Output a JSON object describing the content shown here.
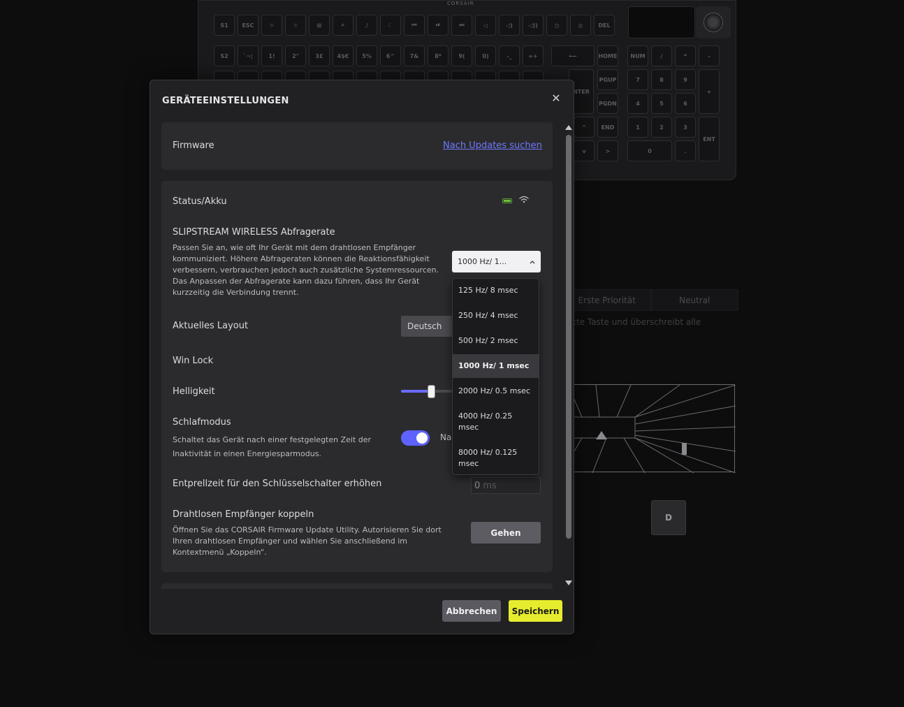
{
  "background": {
    "brand": "CORSAIR",
    "keys": {
      "row1": [
        "S1",
        "ESC",
        "☼",
        "☼",
        "⊞",
        "⌕",
        "♪",
        "☾",
        "⏮",
        "⏯",
        "⏭",
        "◁",
        "◁)",
        "◁))",
        "◷",
        "◎",
        "DEL"
      ],
      "row2": [
        "S2",
        "`¬¦",
        "1!",
        "2\"",
        "3£",
        "4$€",
        "5%",
        "6^",
        "7&",
        "8*",
        "9(",
        "0)",
        "-_",
        "=+",
        "⟵",
        "HOME"
      ],
      "numpad": [
        "NUM",
        "/",
        "*",
        "-",
        "7",
        "8",
        "9",
        "+",
        "4",
        "5",
        "6",
        "1",
        "2",
        "3",
        "ENT",
        "0",
        "."
      ],
      "nav": [
        "NTER",
        "PGUP",
        "PGDN",
        "^",
        "END",
        "v",
        ">"
      ]
    },
    "priority_left": "Erste Priorität",
    "priority_right": "Neutral",
    "desc": "kte Taste und überschreibt alle",
    "d_key": "D"
  },
  "modal": {
    "title": "GERÄTEEINSTELLUNGEN",
    "close": "✕",
    "firmware": {
      "label": "Firmware",
      "link": "Nach Updates suchen"
    },
    "status": {
      "label": "Status/Akku"
    },
    "polling": {
      "title": "SLIPSTREAM WIRELESS Abfragerate",
      "desc_lines": [
        "Passen Sie an, wie oft Ihr Gerät mit dem drahtlosen Empfänger",
        "kommuniziert. Höhere Abfrageraten können die Reaktionsfähigkeit",
        "verbessern, verbrauchen jedoch auch zusätzliche Systemressourcen.",
        "Das Anpassen der Abfragerate kann dazu führen, dass Ihr Gerät",
        "kurzzeitig die Verbindung trennt."
      ],
      "selected": "1000 Hz/ 1...",
      "options": [
        [
          "125 Hz/ 8 msec"
        ],
        [
          "250 Hz/ 4 msec"
        ],
        [
          "500 Hz/ 2 msec"
        ],
        [
          "1000 Hz/ 1 msec"
        ],
        [
          "2000 Hz/ 0.5 msec"
        ],
        [
          "4000 Hz/ 0.25",
          "msec"
        ],
        [
          "8000 Hz/ 0.125",
          "msec"
        ]
      ],
      "selected_index": 3
    },
    "layout": {
      "label": "Aktuelles Layout",
      "value": "Deutsch"
    },
    "winlock": {
      "label": "Win Lock"
    },
    "brightness": {
      "label": "Helligkeit",
      "level": 0.55
    },
    "sleep": {
      "label": "Schlafmodus",
      "desc_lines": [
        "Schaltet das Gerät nach einer festgelegten Zeit der",
        "Inaktivität in einen Energiesparmodus."
      ],
      "enabled": true,
      "after_text": "Na"
    },
    "debounce": {
      "label": "Entprellzeit für den Schlüsselschalter erhöhen",
      "value": "0",
      "unit": "ms"
    },
    "pair": {
      "label": "Drahtlosen Empfänger koppeln",
      "desc_lines": [
        "Öffnen Sie das CORSAIR Firmware Update Utility. Autorisieren Sie dort",
        "Ihren drahtlosen Empfänger und wählen Sie anschließend im",
        "Kontextmenü „Koppeln“."
      ],
      "button": "Gehen"
    },
    "cancel": "Abbrechen",
    "save": "Speichern"
  },
  "colors": {
    "accent": "#5e62ff",
    "save": "#e6ec2d",
    "battery": "#6cc23e",
    "link": "#6f78ff"
  }
}
